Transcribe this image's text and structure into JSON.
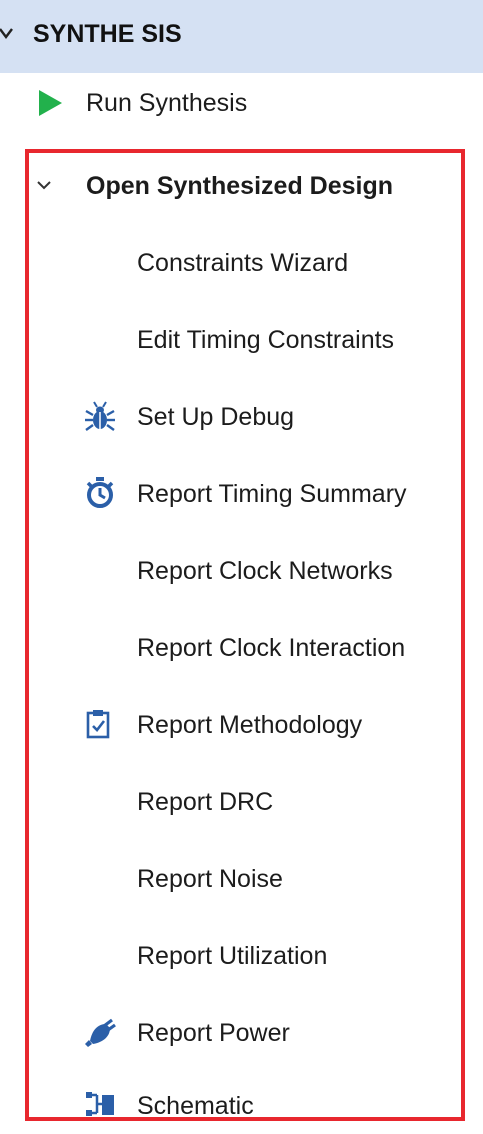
{
  "section": {
    "title": "SYNTHE SIS",
    "expanded": true
  },
  "run_synthesis": {
    "label": "Run Synthesis",
    "icon": "play-icon",
    "icon_color": "#22b14c"
  },
  "open_design": {
    "label": "Open Synthesized Design",
    "expanded": true,
    "highlight_color": "#e8272e",
    "items": [
      {
        "label": "Constraints Wizard",
        "icon": null
      },
      {
        "label": "Edit Timing Constraints",
        "icon": null
      },
      {
        "label": "Set Up Debug",
        "icon": "bug-icon"
      },
      {
        "label": "Report Timing Summary",
        "icon": "stopwatch-icon"
      },
      {
        "label": "Report Clock Networks",
        "icon": null
      },
      {
        "label": "Report Clock Interaction",
        "icon": null
      },
      {
        "label": "Report Methodology",
        "icon": "clipboard-check-icon"
      },
      {
        "label": "Report DRC",
        "icon": null
      },
      {
        "label": "Report Noise",
        "icon": null
      },
      {
        "label": "Report Utilization",
        "icon": null
      },
      {
        "label": "Report Power",
        "icon": "power-plug-icon"
      },
      {
        "label": "Schematic",
        "icon": "schematic-icon"
      }
    ]
  },
  "colors": {
    "header_bg": "#d5e1f3",
    "icon_blue": "#2b5fa8"
  }
}
